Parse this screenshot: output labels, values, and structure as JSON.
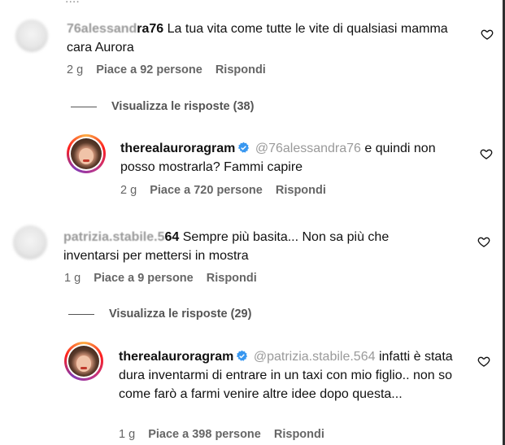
{
  "comments": [
    {
      "username_blur": "76alessand",
      "username_visible": "ra76",
      "text": "La tua vita come tutte le vite di qualsiasi mamma cara Aurora",
      "time": "2 g",
      "likes": "Piace a 92 persone",
      "reply": "Rispondi",
      "view_replies": "Visualizza le risposte (38)"
    },
    {
      "username": "therealauroragram",
      "mention_blur": "@76alessandra76",
      "text": "e quindi non posso mostrarla? Fammi capire",
      "time": "2 g",
      "likes": "Piace a 720 persone",
      "reply": "Rispondi"
    },
    {
      "username_blur": "patrizia.stabile.5",
      "username_visible": "64",
      "text": "Sempre più basita... Non sa più che inventarsi per mettersi in mostra",
      "time": "1 g",
      "likes": "Piace a 9 persone",
      "reply": "Rispondi",
      "view_replies": "Visualizza le risposte (29)"
    },
    {
      "username": "therealauroragram",
      "mention_blur": "@patrizia.stabile.564",
      "text": "infatti è stata dura inventarmi di entrare in un taxi con mio figlio.. non so come farò a farmi venire altre idee dopo questa...",
      "time": "1 g",
      "likes": "Piace a 398 persone",
      "reply": "Rispondi"
    }
  ],
  "icons": {
    "like": "heart-icon",
    "verified": "verified-badge-icon"
  },
  "colors": {
    "verified": "#3897f0",
    "text": "#111111",
    "meta": "#666666"
  }
}
